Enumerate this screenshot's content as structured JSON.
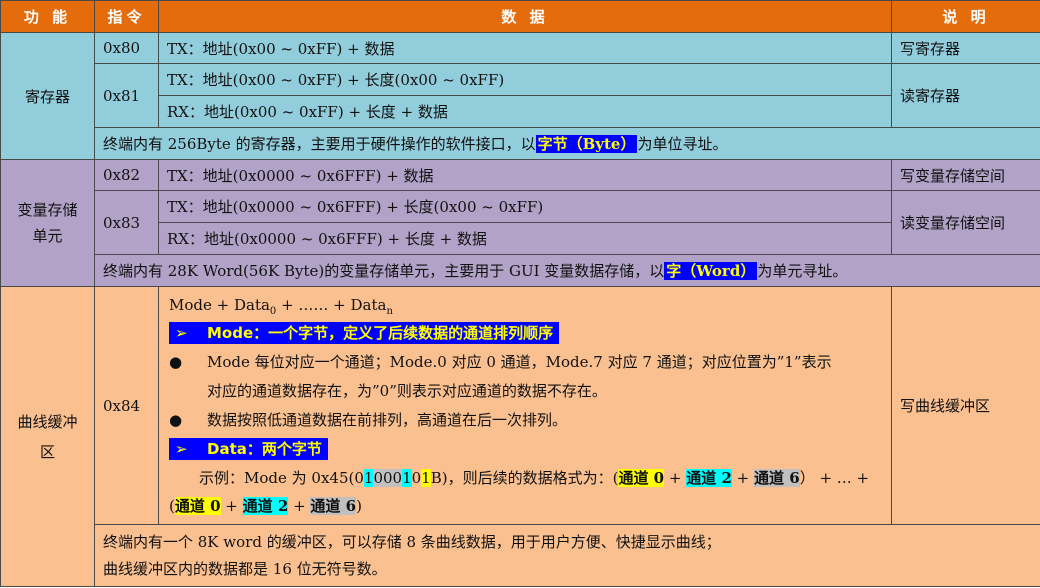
{
  "header": {
    "func": "功 能",
    "cmd": "指令",
    "data": "数 据",
    "desc": "说 明"
  },
  "register": {
    "name": "寄存器",
    "cmd1": "0x80",
    "tx1": "TX：地址(0x00 ~ 0xFF) +  数据",
    "desc1": "写寄存器",
    "cmd2": "0x81",
    "tx2": "TX：地址(0x00 ~ 0xFF) +  长度(0x00 ~ 0xFF)",
    "rx2": "RX：地址(0x00 ~ 0xFF) +  长度  +  数据",
    "desc2": "读寄存器",
    "note_pre": "终端内有 256Byte 的寄存器，主要用于硬件操作的软件接口，以",
    "note_hl": "字节（Byte）",
    "note_post": "为单位寻址。"
  },
  "variable": {
    "name1": "变量存储",
    "name2": "单元",
    "cmd1": "0x82",
    "tx1": "TX：地址(0x0000 ~ 0x6FFF) +  数据",
    "desc1": "写变量存储空间",
    "cmd2": "0x83",
    "tx2": "TX：地址(0x0000 ~ 0x6FFF) +  长度(0x00 ~ 0xFF)",
    "rx2": "RX：地址(0x0000 ~ 0x6FFF) +  长度  +  数据",
    "desc2": "读变量存储空间",
    "note_pre": "终端内有 28K Word(56K Byte)的变量存储单元，主要用于 GUI 变量数据存储，以",
    "note_hl": "字（Word）",
    "note_post": "为单元寻址。"
  },
  "curve": {
    "name1": "曲线缓冲",
    "name2": "区",
    "cmd": "0x84",
    "desc": "写曲线缓冲区",
    "formula_a": "Mode + Data",
    "formula_sub0": "0",
    "formula_b": " + …… + Data",
    "formula_subn": "n",
    "arrow": "➢",
    "mode_title": "Mode：一个字节，定义了后续数据的通道排列顺序",
    "bullet": "●",
    "b1_l1": "Mode 每位对应一个通道；Mode.0 对应 0 通道，Mode.7 对应 7 通道；对应位置为”1”表示",
    "b1_l2": "对应的通道数据存在，为”0”则表示对应通道的数据不存在。",
    "b2": "数据按照低通道数据在前排列，高通道在后一次排列。",
    "data_title": "Data：两个字节",
    "ex_pre": "示例：Mode 为 0x45(0",
    "ex_b1": "1",
    "ex_mid1": "000",
    "ex_b2": "1",
    "ex_mid2": "0",
    "ex_b3": "1",
    "ex_post": "B)，则后续的数据格式为：(",
    "ch0": "通道 0",
    "plus": " + ",
    "ch2": "通道 2",
    "ch6": "通道 6",
    "ex_tail": "）  + … +",
    "open": "(",
    "close": ")",
    "note1": "终端内有一个 8K word 的缓冲区，可以存储 8 条曲线数据，用于用户方便、快捷显示曲线；",
    "note2": "曲线缓冲区内的数据都是 16 位无符号数。"
  }
}
